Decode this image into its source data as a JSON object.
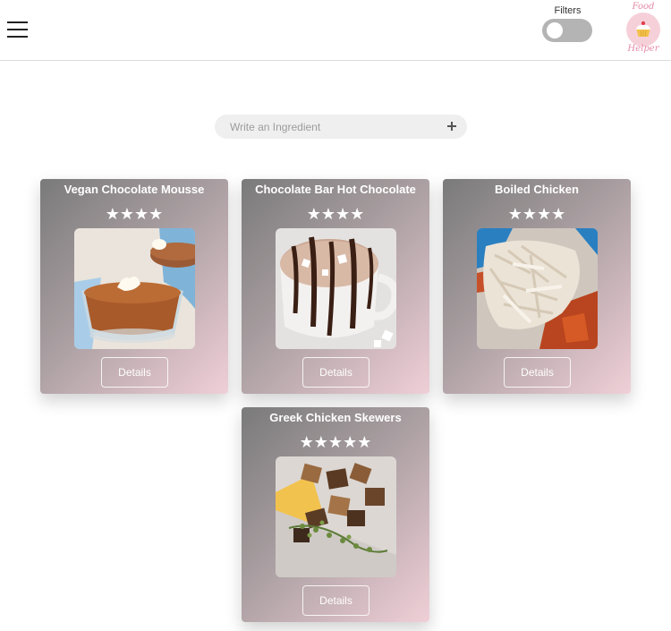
{
  "header": {
    "filters_label": "Filters",
    "filters_enabled": false,
    "logo_top_text": "Food",
    "logo_bottom_text": "Helper"
  },
  "search": {
    "placeholder": "Write an Ingredient",
    "value": ""
  },
  "colors": {
    "toggle_off": "#b4b4b4",
    "logo_pink": "#e58aa6",
    "card_gradient_start": "#7a7a7a",
    "card_gradient_end": "#f0cfd7"
  },
  "recipes": [
    {
      "title": "Vegan Chocolate Mousse",
      "stars": "★★★★",
      "rating": 4,
      "details_label": "Details",
      "image": "chocolate-mousse-photo"
    },
    {
      "title": "Chocolate Bar Hot Chocolate",
      "stars": "★★★★",
      "rating": 4,
      "details_label": "Details",
      "image": "hot-chocolate-photo"
    },
    {
      "title": "Boiled Chicken",
      "stars": "★★★★",
      "rating": 4,
      "details_label": "Details",
      "image": "boiled-chicken-photo"
    },
    {
      "title": "Greek Chicken Skewers",
      "stars": "★★★★★",
      "rating": 5,
      "details_label": "Details",
      "image": "chicken-skewers-photo"
    }
  ]
}
